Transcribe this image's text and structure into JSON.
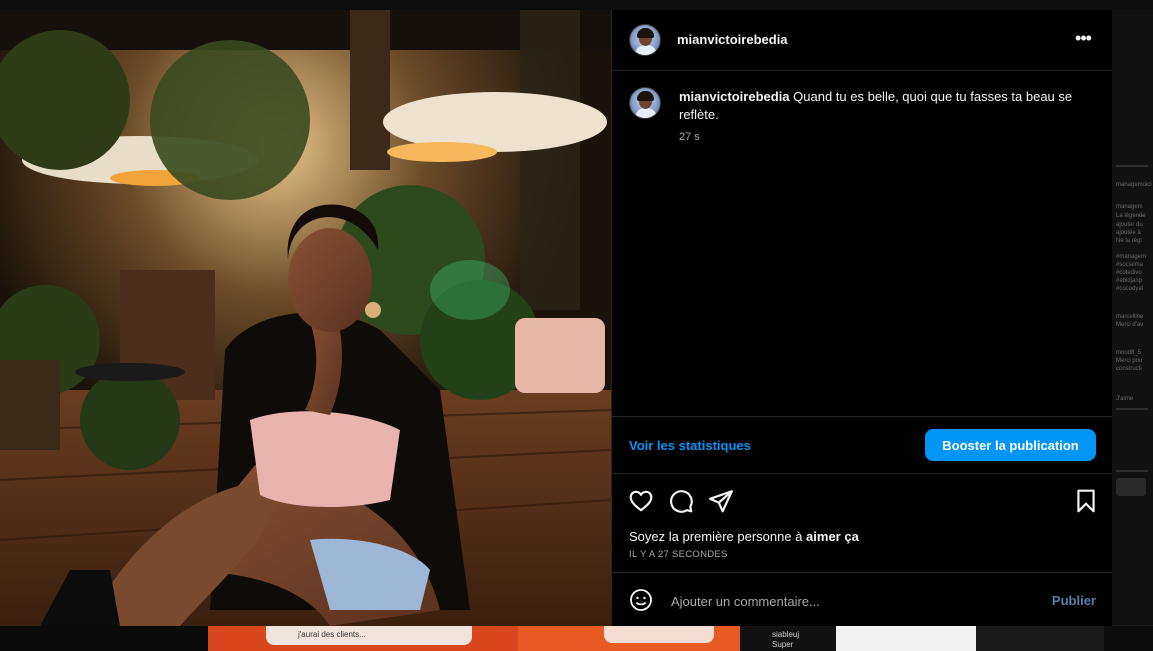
{
  "post": {
    "username": "mianvictoirebedia",
    "more_icon": "•••",
    "caption_username": "mianvictoirebedia",
    "caption_text": " Quand tu es belle, quoi que tu fasses ta beau se reflète.",
    "caption_time": "27 s",
    "stats_link": "Voir les statistiques",
    "boost_button": "Booster la publication",
    "likes_prefix": "Soyez la première personne à ",
    "likes_bold": "aimer ça",
    "posted_ago": "IL Y A 27 SECONDES",
    "comment_placeholder": "Ajouter un commentaire...",
    "publish_label": "Publier"
  },
  "background": {
    "bottom_text_1": "j'aurai des clients...",
    "bottom_text_2": "siableuj",
    "bottom_text_3": "Super",
    "right_texts": [
      "managemoici",
      "managem",
      "La légende",
      "ajouter du",
      "ajoutée à",
      "Ne la régl",
      "#managem",
      "#socialma",
      "#cotedivo",
      "#abidjanp",
      "#cocodyal",
      "marcelline",
      "Merci d'av",
      "mood8_5",
      "Merci pou",
      "constructi",
      "J'aime"
    ]
  },
  "icons": {
    "more": "more-options-icon",
    "heart": "heart-icon",
    "comment": "comment-icon",
    "share": "share-icon",
    "save": "bookmark-icon",
    "emoji": "emoji-icon"
  },
  "colors": {
    "accent": "#0095f6",
    "panel_bg": "#000000",
    "muted_text": "#a8a8a8",
    "publish_disabled": "#5a7fa8"
  }
}
